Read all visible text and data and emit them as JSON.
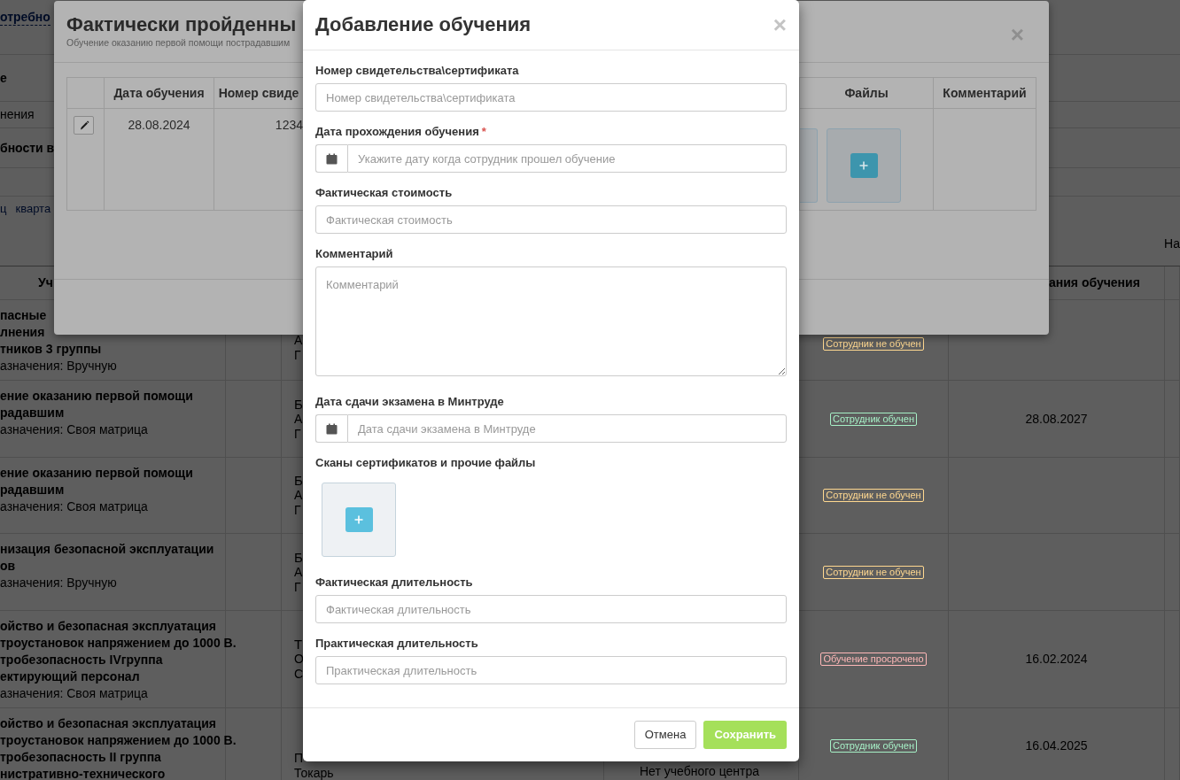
{
  "page": {
    "top_link": "отребно",
    "section_rows": [
      {
        "text": "е",
        "kind": "heading"
      },
      {
        "text": "нения",
        "kind": "muted"
      },
      {
        "text": "бности в",
        "kind": "heading"
      }
    ],
    "period_links": [
      "ц",
      "кварта"
    ],
    "right_label": "На",
    "table": {
      "columns": [
        "Уч",
        "ания обучения"
      ],
      "rows": [
        {
          "course_lines": [
            "пасные",
            "лнения",
            "тников 3 группы"
          ],
          "assignment": "азначения: Вручную",
          "person_lines": [
            "А",
            "Г"
          ],
          "status": {
            "text": "Сотрудник не обучен",
            "kind": "not_trained"
          }
        },
        {
          "course_lines": [
            "ение оказанию первой помощи",
            "радавшим"
          ],
          "assignment": "азначения: Своя матрица",
          "person_lines": [
            "Б",
            "А",
            "Г"
          ],
          "status": {
            "text": "Сотрудник обучен",
            "kind": "trained"
          },
          "date": "28.08.2027"
        },
        {
          "course_lines": [
            "ение оказанию первой помощи",
            "радавшим"
          ],
          "assignment": "азначения: Своя матрица",
          "person_lines": [
            "Б",
            "А",
            "Г"
          ],
          "status": {
            "text": "Сотрудник не обучен",
            "kind": "not_trained"
          }
        },
        {
          "course_lines": [
            "низация безопасной эксплуатации",
            "ов"
          ],
          "assignment": "азначения: Вручную",
          "person_lines": [
            "Б",
            "А",
            "Г"
          ],
          "status": {
            "text": "Сотрудник не обучен",
            "kind": "not_trained"
          }
        },
        {
          "course_lines": [
            "ойство и безопасная эксплуатация",
            "троустановок напряжением до 1000 В.",
            "тробезопасность IVгруппа",
            "ектирующий персонал"
          ],
          "assignment": "азначения: Своя матрица",
          "person_lines": [
            "Т",
            "О",
            "С"
          ],
          "status": {
            "text": "Обучение просрочено",
            "kind": "overdue"
          },
          "date": "16.02.2024"
        },
        {
          "course_lines": [
            "ойство и безопасная эксплуатация",
            "троустановок напряжением до 1000 В.",
            "тробезопасность II группа",
            "нистративно-технического"
          ],
          "person_lines": [
            "П",
            "Токарь"
          ],
          "center": "Нет учебного центра",
          "status": {
            "text": "Сотрудник обучен",
            "kind": "trained"
          },
          "date": "16.04.2025"
        }
      ]
    }
  },
  "facts_modal": {
    "title": "Фактически пройденны",
    "subtitle": "Обучение оказанию первой помощи пострадавшим",
    "close": "×",
    "columns": [
      "Дата обучения",
      "Номер свиде",
      "Файлы",
      "Комментарий"
    ],
    "rows": [
      {
        "date": "28.08.2024",
        "number": "1234"
      }
    ]
  },
  "add_modal": {
    "title": "Добавление обучения",
    "close": "×",
    "fields": [
      {
        "kind": "text",
        "label": "Номер свидетельства\\сертификата",
        "placeholder": "Номер свидетельства\\сертификата"
      },
      {
        "kind": "date",
        "label": "Дата прохождения обучения",
        "required_mark": "*",
        "placeholder": "Укажите дату когда сотрудник прошел обучение"
      },
      {
        "kind": "text",
        "label": "Фактическая стоимость",
        "placeholder": "Фактическая стоимость"
      },
      {
        "kind": "textarea",
        "label": "Комментарий",
        "placeholder": "Комментарий"
      },
      {
        "kind": "date",
        "label": "Дата сдачи экзамена в Минтруде",
        "placeholder": "Дата сдачи экзамена в Минтруде"
      },
      {
        "kind": "files",
        "label": "Сканы сертификатов и прочие файлы"
      },
      {
        "kind": "text",
        "label": "Фактическая длительность",
        "placeholder": "Фактическая длительность"
      },
      {
        "kind": "text",
        "label": "Практическая длительность",
        "placeholder": "Практическая длительность"
      }
    ],
    "buttons": [
      {
        "kind": "default",
        "label": "Отмена"
      },
      {
        "kind": "primary",
        "label": "Сохранить"
      }
    ]
  }
}
